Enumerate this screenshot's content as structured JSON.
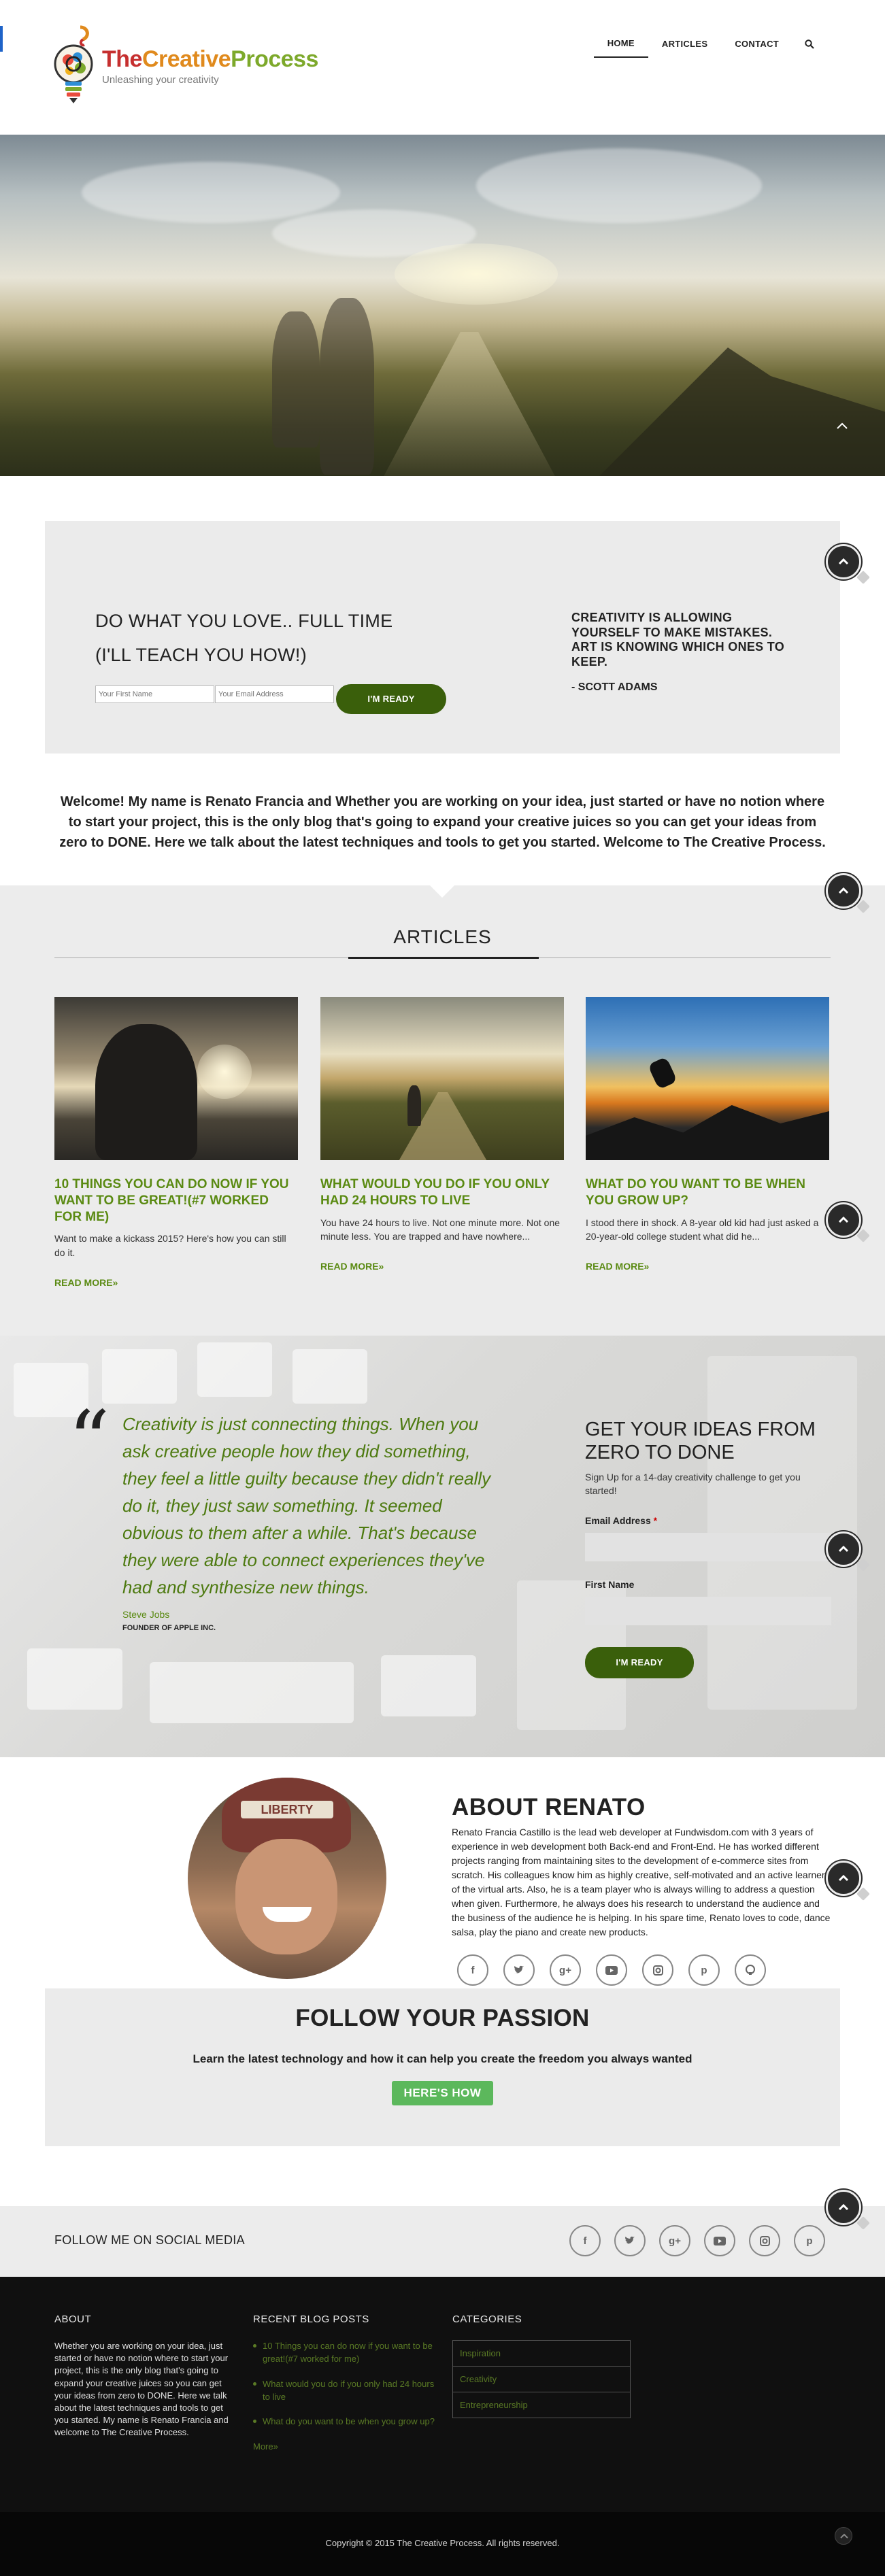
{
  "header": {
    "logo": {
      "title_part1": "The",
      "title_part2": "Creative",
      "title_part3": "Process",
      "tagline": "Unleashing your creativity"
    },
    "nav": [
      {
        "label": "HOME",
        "active": true
      },
      {
        "label": "ARTICLES",
        "active": false
      },
      {
        "label": "CONTACT",
        "active": false
      }
    ],
    "search_icon": "search-icon"
  },
  "optin": {
    "heading_line1": "DO WHAT YOU LOVE.. FULL TIME",
    "heading_line2": "(I'LL TEACH YOU HOW!)",
    "first_name_placeholder": "Your First Name",
    "email_placeholder": "Your Email Address",
    "button": "I'M READY",
    "quote": "CREATIVITY IS ALLOWING YOURSELF TO MAKE MISTAKES. ART IS KNOWING WHICH ONES TO KEEP.",
    "quote_author": "- SCOTT ADAMS"
  },
  "welcome": "Welcome! My name is Renato Francia and Whether you are working on your idea, just started or have no notion where to start your project, this is the only blog that's going to expand your creative juices so you can get your ideas from zero to DONE. Here we talk about the latest techniques and tools to get you started. Welcome to The Creative Process.",
  "articles": {
    "title": "ARTICLES",
    "items": [
      {
        "title": "10 THINGS YOU CAN DO NOW IF YOU WANT TO BE GREAT!(#7 WORKED FOR ME)",
        "excerpt": "Want to make a kickass 2015? Here's how you can still do it.",
        "more": "READ MORE»"
      },
      {
        "title": "WHAT WOULD YOU DO IF YOU ONLY HAD 24 HOURS TO LIVE",
        "excerpt": "You have 24 hours to live. Not one minute more. Not one minute less. You are trapped and have nowhere...",
        "more": "READ MORE»"
      },
      {
        "title": "WHAT DO YOU WANT TO BE WHEN YOU GROW UP?",
        "excerpt": "I stood there in shock. A 8-year old kid had just asked a 20-year-old college student what did he...",
        "more": "READ MORE»"
      }
    ]
  },
  "signup": {
    "quote_mark": "“",
    "quote": "Creativity is just connecting things. When you ask creative people how they did something, they feel a little guilty because they didn't really do it, they just saw something. It seemed obvious to them after a while. That's because they were able to connect experiences they've had and synthesize new things.",
    "quote_author": "Steve Jobs",
    "quote_role": "FOUNDER OF APPLE INC.",
    "heading": "GET YOUR IDEAS FROM ZERO TO DONE",
    "subtext": "Sign Up for a 14-day creativity challenge to get you started!",
    "email_label": "Email Address",
    "required_mark": "*",
    "first_name_label": "First Name",
    "button": "I'M READY"
  },
  "about": {
    "title": "ABOUT RENATO",
    "text": "Renato Francia Castillo is the lead web developer at Fundwisdom.com with 3 years of experience in web development both Back-end and Front-End. He has worked different projects ranging from maintaining sites to the development of e-commerce sites from scratch. His colleagues know him as highly creative, self-motivated and an active learner of the virtual arts. Also, he is a team player who is always willing to address a question when given. Furthermore, he always does his research to understand the audience and the business of the audience he is helping. In his spare time, Renato loves to code, dance salsa, play the piano and create new products.",
    "cap_text": "LIBERTY",
    "social": [
      "facebook-icon",
      "twitter-icon",
      "google-plus-icon",
      "youtube-icon",
      "instagram-icon",
      "pinterest-icon",
      "github-icon"
    ]
  },
  "passion": {
    "title": "FOLLOW YOUR PASSION",
    "subtitle": "Learn the latest technology and how it can help you create the freedom you always wanted",
    "button": "HERE'S HOW"
  },
  "social_strip": {
    "label": "FOLLOW ME ON SOCIAL MEDIA",
    "icons": [
      "facebook-icon",
      "twitter-icon",
      "google-plus-icon",
      "youtube-icon",
      "instagram-icon",
      "pinterest-icon"
    ]
  },
  "footer": {
    "about_title": "ABOUT",
    "about_text": "Whether you are working on your idea, just started or have no notion where to start your project, this is the only blog that's going to expand your creative juices so you can get your ideas from zero to DONE. Here we talk about the latest techniques and tools to get you started. My name is Renato Francia and welcome to The Creative Process.",
    "posts_title": "RECENT BLOG POSTS",
    "posts": [
      "10 Things you can do now if you want to be great!(#7 worked for me)",
      "What would you do if you only had 24 hours to live",
      "What do you want to be when you grow up?"
    ],
    "more": "More»",
    "categories_title": "CATEGORIES",
    "categories": [
      "Inspiration",
      "Creativity",
      "Entrepreneurship"
    ],
    "copyright": "Copyright © 2015 The Creative Process. All rights reserved."
  },
  "colors": {
    "accent_green": "#5a8a12",
    "button_green": "#3a5f0b",
    "cta_green": "#5cb85c",
    "footer_bg": "#101010"
  }
}
